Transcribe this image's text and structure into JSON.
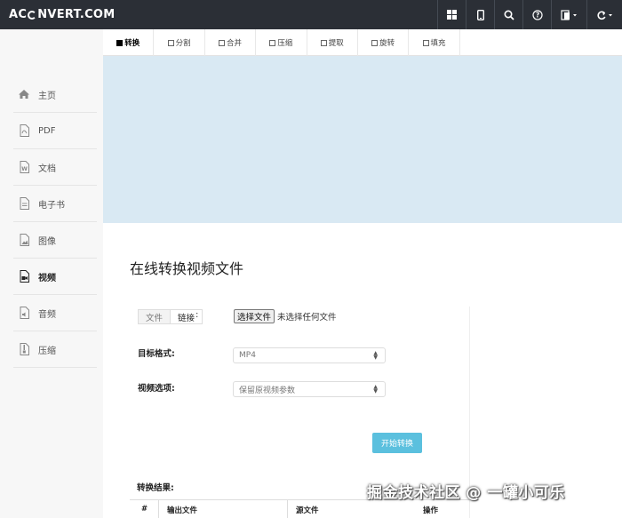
{
  "header": {
    "logo_left": "AC",
    "logo_right": "NVERT.COM"
  },
  "icons": {
    "top": [
      "grid-icon",
      "mobile-icon",
      "search-icon",
      "help-icon",
      "language-icon",
      "refresh-icon"
    ]
  },
  "sidebar": {
    "items": [
      {
        "label": "主页",
        "icon": "home-icon"
      },
      {
        "label": "PDF",
        "icon": "pdf-icon"
      },
      {
        "label": "文档",
        "icon": "document-icon"
      },
      {
        "label": "电子书",
        "icon": "ebook-icon"
      },
      {
        "label": "图像",
        "icon": "image-icon"
      },
      {
        "label": "视频",
        "icon": "video-icon"
      },
      {
        "label": "音频",
        "icon": "audio-icon"
      },
      {
        "label": "压缩",
        "icon": "archive-icon"
      }
    ],
    "active_index": 5
  },
  "tabs": [
    "转换",
    "分割",
    "合并",
    "压缩",
    "提取",
    "旋转",
    "填充"
  ],
  "main": {
    "title": "在线转换视频文件",
    "source_toggle": {
      "file": "文件",
      "link": "链接",
      "colon": ":"
    },
    "file_button": "选择文件",
    "file_status": "未选择任何文件",
    "target_format_label": "目标格式:",
    "target_format_value": "MP4",
    "video_options_label": "视频选项:",
    "video_options_value": "保留原视频参数",
    "start_button": "开始转换",
    "result_label": "转换结果:",
    "table_headers": [
      "#",
      "输出文件",
      "源文件",
      "操作"
    ]
  },
  "watermark": "掘金技术社区 @ 一罐小可乐",
  "colors": {
    "topbar": "#2b2f36",
    "banner": "#d9e9f3",
    "start_button": "#5bc0de",
    "sidebar": "#f7f7f7"
  }
}
